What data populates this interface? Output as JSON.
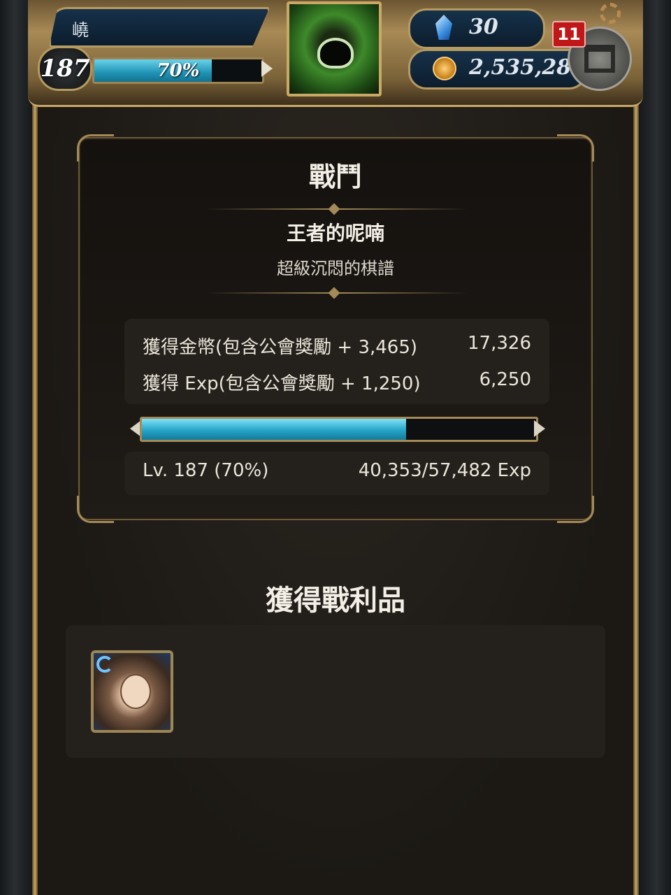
{
  "hud": {
    "player_name": "嶢",
    "level": "187",
    "exp_percent_text": "70%",
    "exp_fraction": 0.7,
    "gems": "30",
    "coins": "2,535,281",
    "notification_count": "11"
  },
  "battle": {
    "title": "戰鬥",
    "stage_name": "王者的呢喃",
    "stage_subtitle": "超級沉悶的棋譜",
    "rewards": [
      {
        "label": "獲得金幣(包含公會獎勵 + 3,465)",
        "value": "17,326"
      },
      {
        "label": "獲得 Exp(包含公會獎勵 + 1,250)",
        "value": "6,250"
      }
    ],
    "progress_fraction": 0.67,
    "level_text": "Lv. 187 (70%)",
    "exp_text": "40,353/57,482 Exp"
  },
  "loot": {
    "title": "獲得戰利品",
    "items": [
      {
        "icon": "character-card-icon"
      }
    ]
  },
  "colors": {
    "accent_gold": "#c9a866",
    "exp_blue": "#25a4c7",
    "badge_red": "#c01818"
  }
}
